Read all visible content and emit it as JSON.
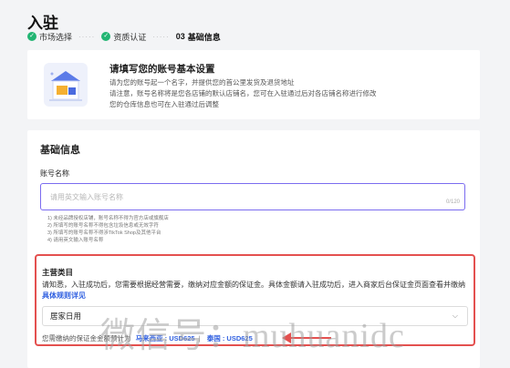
{
  "page": {
    "title": "入驻"
  },
  "steps": [
    {
      "label": "市场选择",
      "status": "done"
    },
    {
      "label": "资质认证",
      "status": "done"
    },
    {
      "num": "03",
      "label": "基础信息",
      "status": "current"
    }
  ],
  "intro": {
    "title": "请填写您的账号基本设置",
    "lines": [
      "请为您的账号起一个名字，并提供您的首公里发货及退货地址",
      "请注意，账号名称将是您各店铺的默认店铺名，您可在入驻通过后对各店铺名称进行修改",
      "您的仓库信息也可在入驻通过后调整"
    ]
  },
  "form": {
    "section_title": "基础信息",
    "account_name": {
      "label": "账号名称",
      "placeholder": "请用英文输入账号名称",
      "counter": "0/120",
      "rules": [
        "1) 未经品牌授权店铺，账号名称不得为官方店或旗舰店",
        "2) 所填写的账号名称不得包含垃圾信息或无效字符",
        "3) 所填写的账号名称不得涉TikTok Shop及其他平台",
        "4) 请用英文输入账号名称"
      ]
    },
    "category": {
      "title": "主营类目",
      "desc_text": "请知悉，入驻成功后，您需要根据经营需要，缴纳对应金额的保证金。具体金额请入驻成功后，进入商家后台保证金页面查看并缴纳",
      "link": "具体规则详见",
      "selected": "居家日用",
      "deposit_prefix": "您需缴纳的保证金金额预计为",
      "deposit_1": "马来西亚 : USD625",
      "deposit_sep": "|",
      "deposit_2": "泰国 : USD625"
    }
  },
  "watermark": "微信号：muhuanidc",
  "colors": {
    "accent": "#7b6cf0",
    "success": "#22b573",
    "highlight": "#e4504f",
    "link": "#3060e0"
  }
}
